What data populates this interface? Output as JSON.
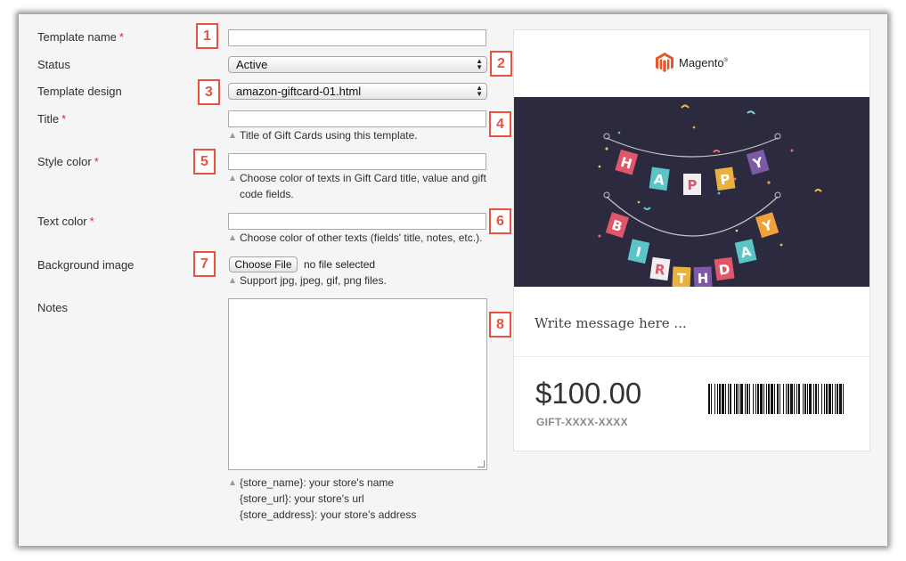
{
  "form": {
    "template_name_label": "Template name",
    "status_label": "Status",
    "status_value": "Active",
    "template_design_label": "Template design",
    "template_design_value": "amazon-giftcard-01.html",
    "title_label": "Title",
    "title_note": "Title of Gift Cards using this template.",
    "style_color_label": "Style color",
    "style_color_note_line1": "Choose color of texts in Gift Card title, value and gift",
    "style_color_note_line2": "code fields.",
    "text_color_label": "Text color",
    "text_color_note": "Choose color of other texts (fields' title, notes, etc.).",
    "background_image_label": "Background image",
    "choose_file_label": "Choose File",
    "no_file_text": "no file selected",
    "background_note": "Support jpg, jpeg, gif, png files.",
    "notes_label": "Notes",
    "notes_hint_1": "{store_name}: your store's name",
    "notes_hint_2": "{store_url}: your store's url",
    "notes_hint_3": "{store_address}: your store's address",
    "required_mark": "*"
  },
  "badges": [
    "1",
    "2",
    "3",
    "4",
    "5",
    "6",
    "7",
    "8"
  ],
  "preview": {
    "logo_text": "Magento",
    "logo_mark": "®",
    "banner_letters_top": [
      "H",
      "A",
      "P",
      "P",
      "Y"
    ],
    "banner_letters_bottom": [
      "B",
      "I",
      "R",
      "T",
      "H",
      "D",
      "A",
      "Y"
    ],
    "message": "Write message here ...",
    "amount": "$100.00",
    "gift_code": "GIFT-XXXX-XXXX"
  },
  "colors": {
    "badge": "#e8523f",
    "required": "#e22626",
    "banner_bg": "#2b2a3f",
    "magento_orange": "#e8562a"
  }
}
